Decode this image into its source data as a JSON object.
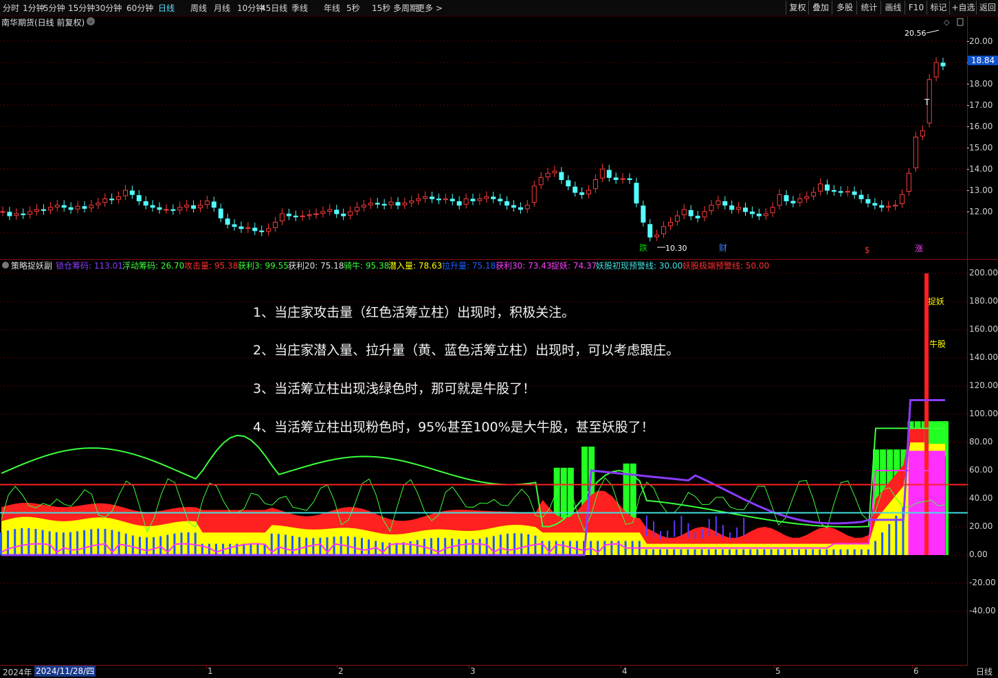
{
  "toolbar": {
    "timeframes": [
      "分时",
      "1分钟",
      "5分钟",
      "15分钟",
      "30分钟",
      "60分钟",
      "日线",
      "周线",
      "月线",
      "10分钟",
      "45日线",
      "季线",
      "年线",
      "5秒",
      "15秒",
      "多周期",
      "更多 >"
    ],
    "active": "日线",
    "right_buttons": [
      "复权",
      "叠加",
      "多股",
      "统计",
      "画线",
      "F10",
      "标记",
      "+自选",
      "返回"
    ]
  },
  "main_chart": {
    "title": "南华期货(日线 前复权)",
    "high_label": "20.56",
    "low_label": "10.30",
    "current_price": "18.84",
    "price_axis": [
      "20.00",
      "19.00",
      "18.00",
      "17.00",
      "16.00",
      "15.00",
      "14.00",
      "13.00",
      "12.00"
    ],
    "markers": [
      {
        "text": "跌",
        "color": "#00d000"
      },
      {
        "text": "财",
        "color": "#4080ff"
      },
      {
        "text": "$",
        "color": "#ff3030"
      },
      {
        "text": "涨",
        "color": "#ff40ff"
      },
      {
        "text": "T",
        "color": "#ffffff"
      }
    ]
  },
  "indicator": {
    "name": "策略捉妖副",
    "legend": [
      {
        "label": "锁仓筹码: 113.01",
        "color": "#8a3cff"
      },
      {
        "label": "浮动筹码: 26.70",
        "color": "#3cff3c"
      },
      {
        "label": "攻击量: 95.38",
        "color": "#ff3030"
      },
      {
        "label": "获利3: 99.55",
        "color": "#3cff3c"
      },
      {
        "label": "获利20: 75.18",
        "color": "#e0e0e0"
      },
      {
        "label": "骑牛: 95.38",
        "color": "#3cff3c"
      },
      {
        "label": "潜入量: 78.63",
        "color": "#ffff00"
      },
      {
        "label": "拉升量: 75.18",
        "color": "#2060ff"
      },
      {
        "label": "获利30: 73.43",
        "color": "#ff40ff"
      },
      {
        "label": "捉妖: 74.37",
        "color": "#ff40ff"
      },
      {
        "label": "妖股初现预警线: 30.00",
        "color": "#40e0e0"
      },
      {
        "label": "妖股极端预警线: 50.00",
        "color": "#ff3030"
      }
    ],
    "axis": [
      "200.00",
      "180.00",
      "160.00",
      "140.00",
      "120.00",
      "100.00",
      "80.00",
      "60.00",
      "40.00",
      "20.00",
      "0.00",
      "-20.00",
      "-40.00"
    ],
    "tags": {
      "zhuoyao": "捉妖",
      "niugu": "牛股"
    },
    "notes": [
      "1、当庄家攻击量（红色活筹立柱）出现时，积极关注。",
      "2、当庄家潜入量、拉升量（黄、蓝色活筹立柱）出现时，可以考虑跟庄。",
      "3、当活筹立柱出现浅绿色时，那可就是牛股了！",
      "4、当活筹立柱出现粉色时，95%甚至100%是大牛股，甚至妖股了！"
    ]
  },
  "date_axis": {
    "year": "2024年",
    "cursor_date": "2024/11/28/四",
    "months": [
      "1",
      "2",
      "3",
      "4",
      "5",
      "6"
    ],
    "period": "日线"
  },
  "colors": {
    "up": "#ff3c3c",
    "down": "#54ffff",
    "grid": "#5a0000",
    "accent": "#5ee0ff"
  }
}
